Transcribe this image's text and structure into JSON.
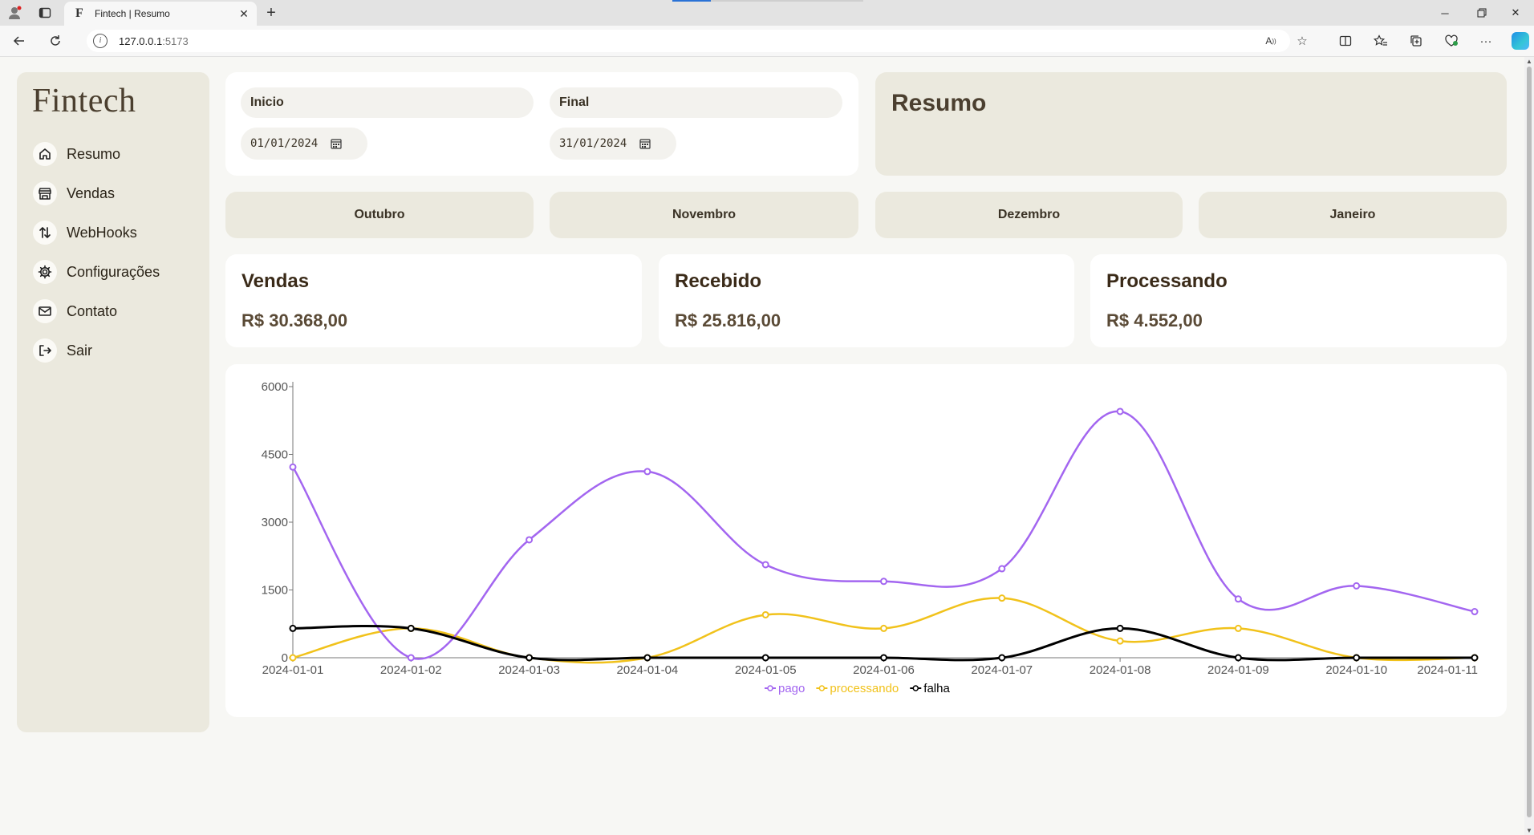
{
  "browser": {
    "tab_title": "Fintech | Resumo",
    "tab_favicon": "F",
    "url_host": "127.0.0.1",
    "url_port": ":5173"
  },
  "sidebar": {
    "logo": "Fintech",
    "items": [
      {
        "label": "Resumo",
        "icon": "home-icon"
      },
      {
        "label": "Vendas",
        "icon": "store-icon"
      },
      {
        "label": "WebHooks",
        "icon": "arrows-updown-icon"
      },
      {
        "label": "Configurações",
        "icon": "gear-icon"
      },
      {
        "label": "Contato",
        "icon": "mail-icon"
      },
      {
        "label": "Sair",
        "icon": "logout-icon"
      }
    ]
  },
  "filters": {
    "start_label": "Inicio",
    "start_value": "01/01/2024",
    "end_label": "Final",
    "end_value": "31/01/2024"
  },
  "header": {
    "title": "Resumo"
  },
  "months": [
    "Outubro",
    "Novembro",
    "Dezembro",
    "Janeiro"
  ],
  "stats": [
    {
      "title": "Vendas",
      "value": "R$ 30.368,00"
    },
    {
      "title": "Recebido",
      "value": "R$ 25.816,00"
    },
    {
      "title": "Processando",
      "value": "R$ 4.552,00"
    }
  ],
  "chart_data": {
    "type": "line",
    "x": [
      "2024-01-01",
      "2024-01-02",
      "2024-01-03",
      "2024-01-04",
      "2024-01-05",
      "2024-01-06",
      "2024-01-07",
      "2024-01-08",
      "2024-01-09",
      "2024-01-10",
      "2024-01-11"
    ],
    "ylim": [
      0,
      6000
    ],
    "yticks": [
      "0",
      "1500",
      "3000",
      "4500",
      "6000"
    ],
    "legend_position": "bottom",
    "grid": false,
    "series": [
      {
        "name": "pago",
        "color": "#a366f0",
        "values": [
          4220,
          0,
          2610,
          4120,
          2060,
          1690,
          1970,
          5450,
          1300,
          1590,
          1020
        ]
      },
      {
        "name": "processando",
        "color": "#f1c21b",
        "values": [
          0,
          650,
          0,
          0,
          950,
          650,
          1320,
          370,
          650,
          0,
          0
        ]
      },
      {
        "name": "falha",
        "color": "#000000",
        "values": [
          650,
          650,
          0,
          0,
          0,
          0,
          0,
          650,
          0,
          0,
          0
        ]
      }
    ]
  }
}
